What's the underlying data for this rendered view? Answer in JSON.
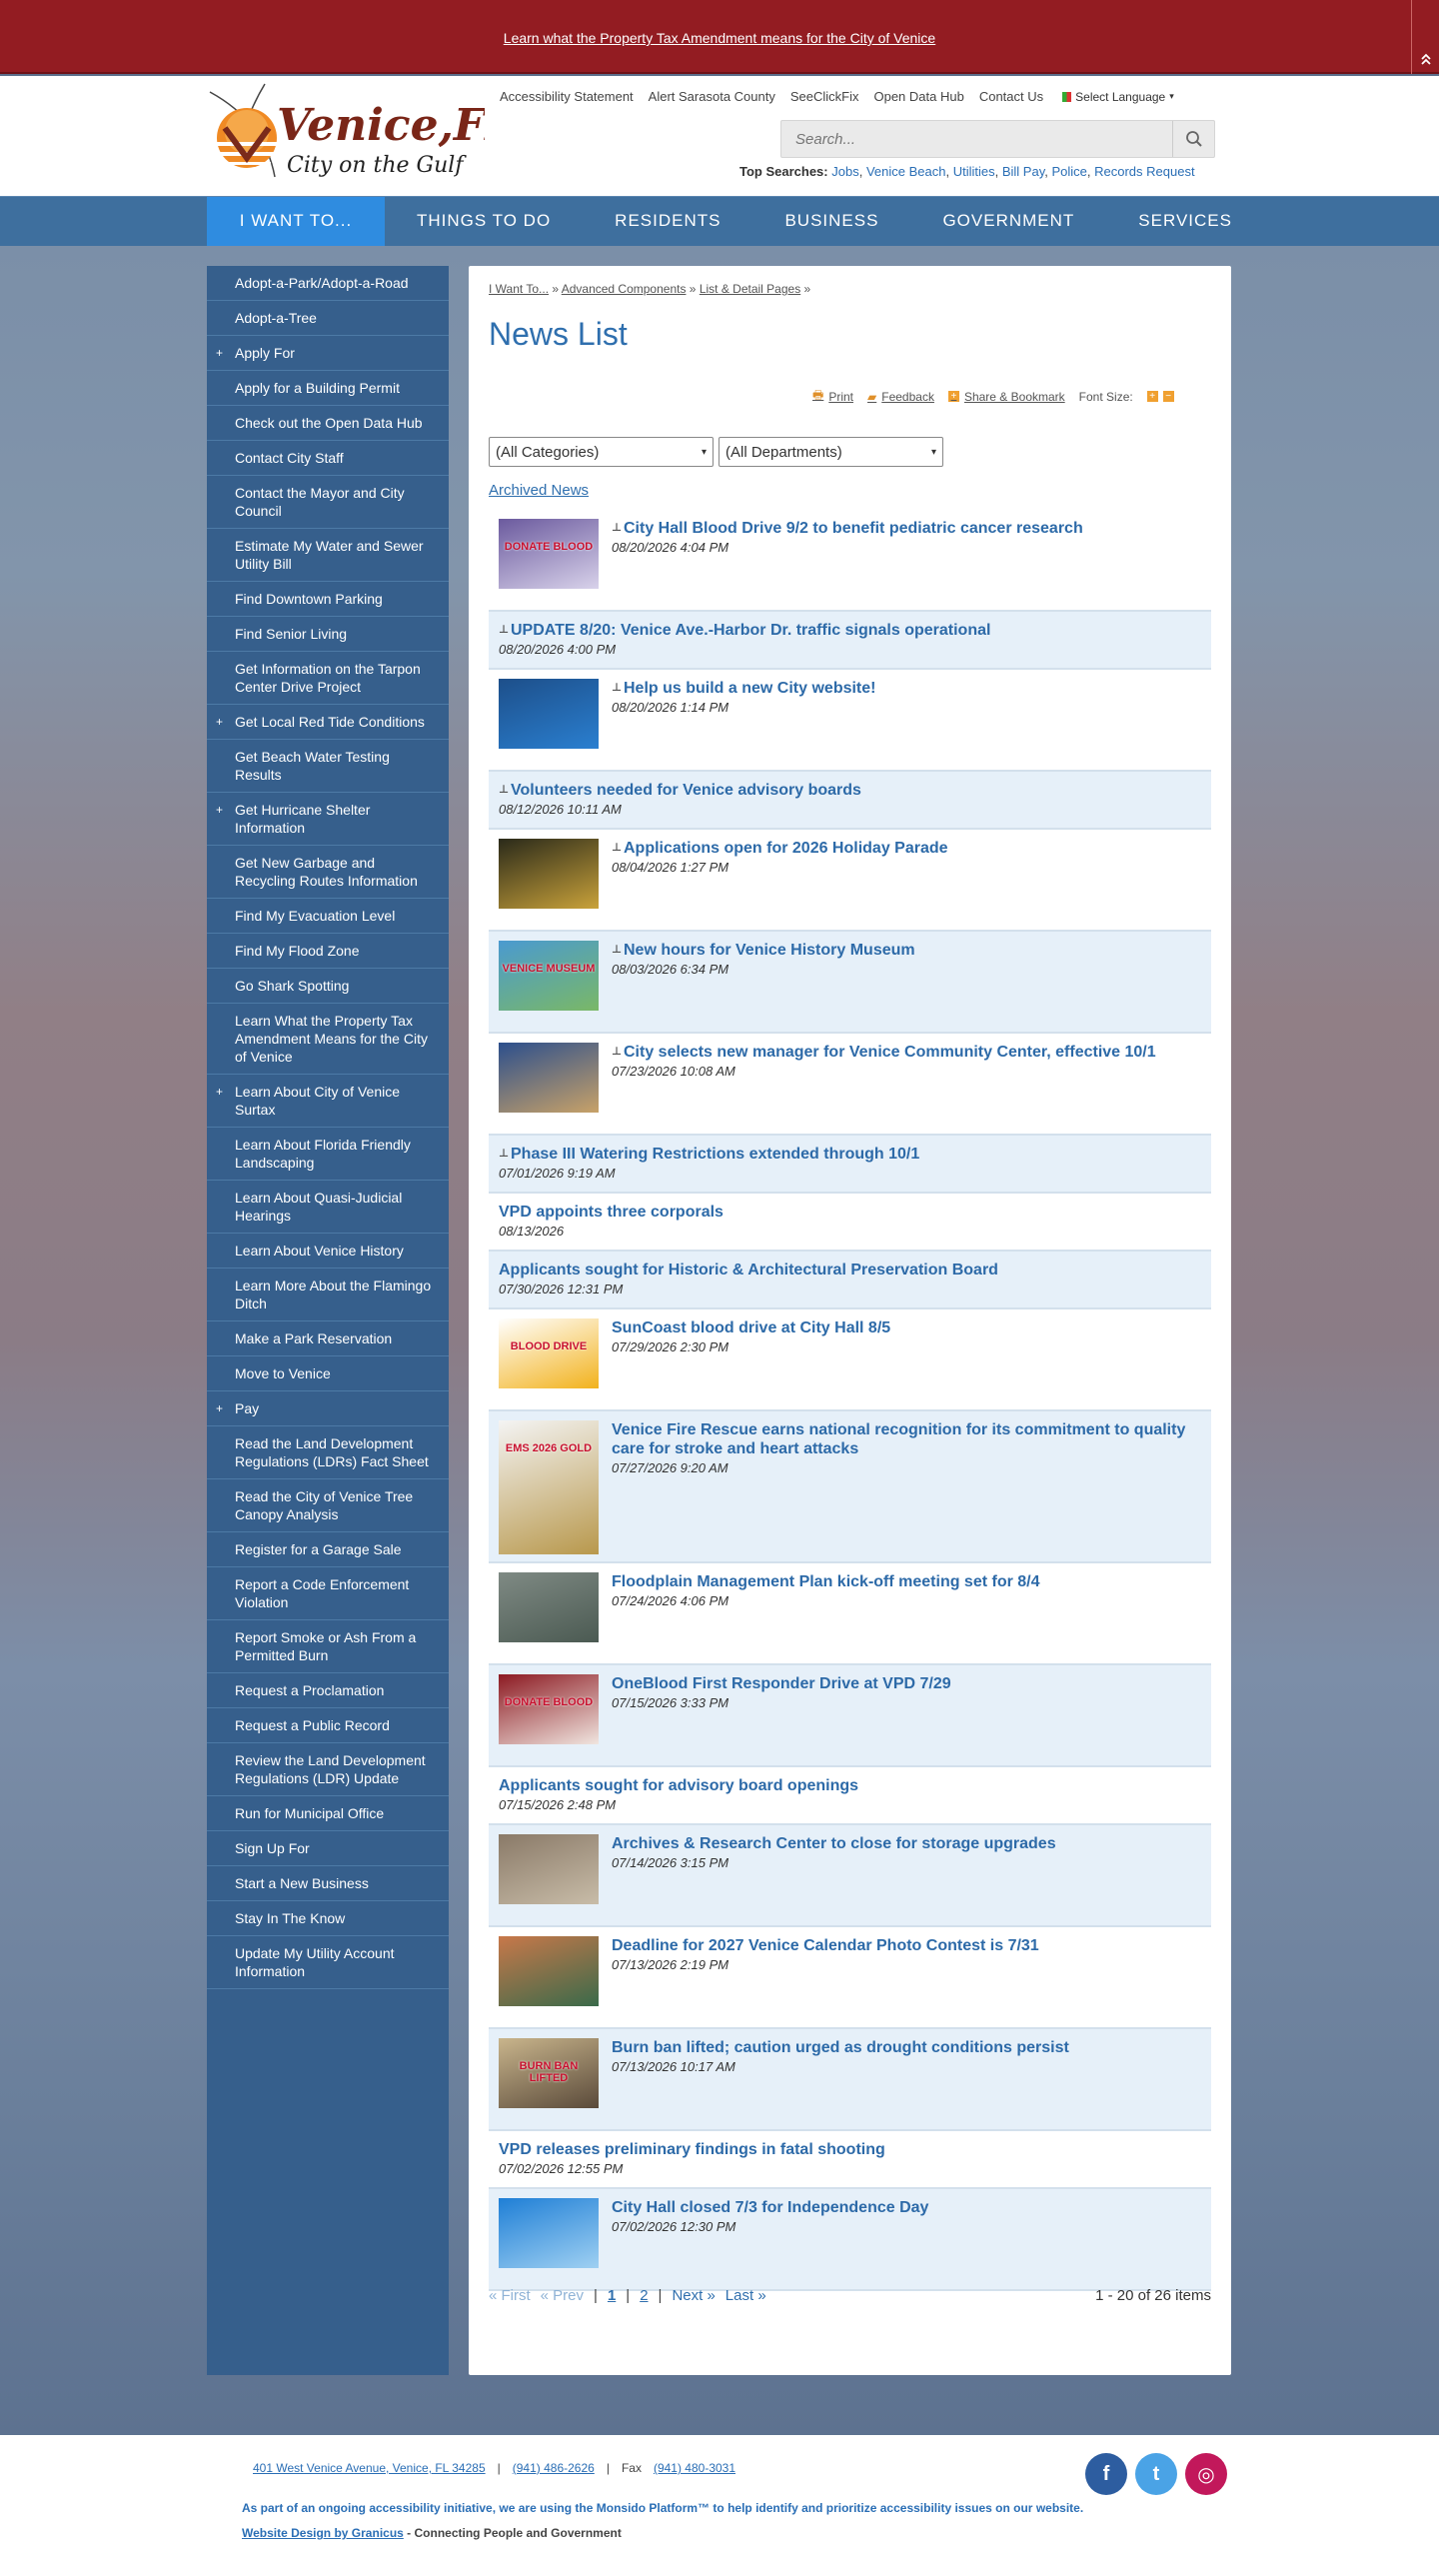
{
  "alert": {
    "message": "Learn what the Property Tax Amendment means for the City of Venice",
    "collapse_icon": "double-chevron-up-icon"
  },
  "header": {
    "logo": {
      "name": "Venice,FL",
      "tagline": "City on the Gulf"
    },
    "utility_links": [
      "Accessibility Statement",
      "Alert Sarasota County",
      "SeeClickFix",
      "Open Data Hub",
      "Contact Us"
    ],
    "language": "Select Language",
    "search": {
      "placeholder": "Search..."
    },
    "top_searches_label": "Top Searches:",
    "top_searches": [
      "Jobs",
      "Venice Beach",
      "Utilities",
      "Bill Pay",
      "Police",
      "Records Request"
    ]
  },
  "nav": [
    "I Want To...",
    "Things To Do",
    "Residents",
    "Business",
    "Government",
    "Services"
  ],
  "sidebar": [
    {
      "label": "Adopt-a-Park/Adopt-a-Road",
      "expandable": false
    },
    {
      "label": "Adopt-a-Tree",
      "expandable": false
    },
    {
      "label": "Apply For",
      "expandable": true
    },
    {
      "label": "Apply for a Building Permit",
      "expandable": false
    },
    {
      "label": "Check out the Open Data Hub",
      "expandable": false
    },
    {
      "label": "Contact City Staff",
      "expandable": false
    },
    {
      "label": "Contact the Mayor and City Council",
      "expandable": false
    },
    {
      "label": "Estimate My Water and Sewer Utility Bill",
      "expandable": false
    },
    {
      "label": "Find Downtown Parking",
      "expandable": false
    },
    {
      "label": "Find Senior Living",
      "expandable": false
    },
    {
      "label": "Get Information on the Tarpon Center Drive Project",
      "expandable": false
    },
    {
      "label": "Get Local Red Tide Conditions",
      "expandable": true
    },
    {
      "label": "Get Beach Water Testing Results",
      "expandable": false
    },
    {
      "label": "Get Hurricane Shelter Information",
      "expandable": true
    },
    {
      "label": "Get New Garbage and Recycling Routes Information",
      "expandable": false
    },
    {
      "label": "Find My Evacuation Level",
      "expandable": false
    },
    {
      "label": "Find My Flood Zone",
      "expandable": false
    },
    {
      "label": "Go Shark Spotting",
      "expandable": false
    },
    {
      "label": "Learn What the Property Tax Amendment Means for the City of Venice",
      "expandable": false
    },
    {
      "label": "Learn About City of Venice Surtax",
      "expandable": true
    },
    {
      "label": "Learn About Florida Friendly Landscaping",
      "expandable": false
    },
    {
      "label": "Learn About Quasi-Judicial Hearings",
      "expandable": false
    },
    {
      "label": "Learn About Venice History",
      "expandable": false
    },
    {
      "label": "Learn More About the Flamingo Ditch",
      "expandable": false
    },
    {
      "label": "Make a Park Reservation",
      "expandable": false
    },
    {
      "label": "Move to Venice",
      "expandable": false
    },
    {
      "label": "Pay",
      "expandable": true
    },
    {
      "label": "Read the Land Development Regulations (LDRs) Fact Sheet",
      "expandable": false
    },
    {
      "label": "Read the City of Venice Tree Canopy Analysis",
      "expandable": false
    },
    {
      "label": "Register for a Garage Sale",
      "expandable": false
    },
    {
      "label": "Report a Code Enforcement Violation",
      "expandable": false
    },
    {
      "label": "Report Smoke or Ash From a Permitted Burn",
      "expandable": false
    },
    {
      "label": "Request a Proclamation",
      "expandable": false
    },
    {
      "label": "Request a Public Record",
      "expandable": false
    },
    {
      "label": "Review the Land Development Regulations (LDR) Update",
      "expandable": false
    },
    {
      "label": "Run for Municipal Office",
      "expandable": false
    },
    {
      "label": "Sign Up For",
      "expandable": false
    },
    {
      "label": "Start a New Business",
      "expandable": false
    },
    {
      "label": "Stay In The Know",
      "expandable": false
    },
    {
      "label": "Update My Utility Account Information",
      "expandable": false
    }
  ],
  "breadcrumb": [
    "I Want To...",
    "Advanced Components",
    "List & Detail Pages"
  ],
  "page_title": "News List",
  "tools": {
    "print": "Print",
    "feedback": "Feedback",
    "share": "Share & Bookmark",
    "font_size": "Font Size:"
  },
  "filters": {
    "category": "(All Categories)",
    "department": "(All Departments)"
  },
  "archived_link": "Archived News",
  "news": [
    {
      "title": "City Hall Blood Drive 9/2 to benefit pediatric cancer research",
      "date": "08/20/2026 4:04 PM",
      "pinned": true,
      "thumb": "donate-blood-flyer",
      "thumb_colors": [
        "#6b5a9e",
        "#d8d2ea"
      ],
      "thumb_text": "DONATE BLOOD"
    },
    {
      "title": "UPDATE 8/20: Venice Ave.-Harbor Dr. traffic signals operational",
      "date": "08/20/2026 4:00 PM",
      "pinned": true
    },
    {
      "title": "Help us build a new City website!",
      "date": "08/20/2026 1:14 PM",
      "pinned": true,
      "thumb": "website-flyer",
      "thumb_colors": [
        "#1d4f8a",
        "#2a7fd0"
      ],
      "thumb_text": ""
    },
    {
      "title": "Volunteers needed for Venice advisory boards",
      "date": "08/12/2026 10:11 AM",
      "pinned": true
    },
    {
      "title": "Applications open for 2026 Holiday Parade",
      "date": "08/04/2026 1:27 PM",
      "pinned": true,
      "thumb": "parade-photo",
      "thumb_colors": [
        "#2a2a1a",
        "#c9a23a"
      ],
      "thumb_text": ""
    },
    {
      "title": "New hours for Venice History Museum",
      "date": "08/03/2026 6:34 PM",
      "pinned": true,
      "thumb": "museum-photo",
      "thumb_colors": [
        "#4a9ad0",
        "#7ab866"
      ],
      "thumb_text": "VENICE MUSEUM"
    },
    {
      "title": "City selects new manager for Venice Community Center, effective 10/1",
      "date": "07/23/2026 10:08 AM",
      "pinned": true,
      "thumb": "community-center-photo",
      "thumb_colors": [
        "#2c4f8c",
        "#c8a268"
      ],
      "thumb_text": ""
    },
    {
      "title": "Phase III Watering Restrictions extended through 10/1",
      "date": "07/01/2026 9:19 AM",
      "pinned": true
    },
    {
      "title": "VPD appoints three corporals",
      "date": "08/13/2026",
      "pinned": false
    },
    {
      "title": "Applicants sought for Historic & Architectural Preservation Board",
      "date": "07/30/2026 12:31 PM",
      "pinned": false
    },
    {
      "title": "SunCoast blood drive at City Hall 8/5",
      "date": "07/29/2026 2:30 PM",
      "pinned": false,
      "thumb": "blood-drive-sun",
      "thumb_colors": [
        "#ffffff",
        "#f2b21c"
      ],
      "thumb_text": "BLOOD DRIVE"
    },
    {
      "title": "Venice Fire Rescue earns national recognition for its commitment to quality care for stroke and heart attacks",
      "date": "07/27/2026 9:20 AM",
      "pinned": false,
      "thumb": "ems-gold-badge",
      "thumb_colors": [
        "#f4f4f4",
        "#b8984c"
      ],
      "thumb_text": "EMS 2026 GOLD"
    },
    {
      "title": "Floodplain Management Plan kick-off meeting set for 8/4",
      "date": "07/24/2026 4:06 PM",
      "pinned": false,
      "thumb": "flood-street-photo",
      "thumb_colors": [
        "#7f8a84",
        "#4b5a52"
      ],
      "thumb_text": ""
    },
    {
      "title": "OneBlood First Responder Drive at VPD 7/29",
      "date": "07/15/2026 3:33 PM",
      "pinned": false,
      "thumb": "oneblood-flyer",
      "thumb_colors": [
        "#8c1a22",
        "#f0e6e0"
      ],
      "thumb_text": "DONATE BLOOD"
    },
    {
      "title": "Applicants sought for advisory board openings",
      "date": "07/15/2026 2:48 PM",
      "pinned": false
    },
    {
      "title": "Archives & Research Center to close for storage upgrades",
      "date": "07/14/2026 3:15 PM",
      "pinned": false,
      "thumb": "archive-shelves-photo",
      "thumb_colors": [
        "#8a7a68",
        "#c8bca8"
      ],
      "thumb_text": ""
    },
    {
      "title": "Deadline for 2027 Venice Calendar Photo Contest is 7/31",
      "date": "07/13/2026 2:19 PM",
      "pinned": false,
      "thumb": "calendar-contest-photo",
      "thumb_colors": [
        "#c8784a",
        "#3a6a4a"
      ],
      "thumb_text": ""
    },
    {
      "title": "Burn ban lifted; caution urged as drought conditions persist",
      "date": "07/13/2026 10:17 AM",
      "pinned": false,
      "thumb": "fire-pit-photo",
      "thumb_colors": [
        "#c9b58c",
        "#5a4a3a"
      ],
      "thumb_text": "BURN BAN LIFTED"
    },
    {
      "title": "VPD releases preliminary findings in fatal shooting",
      "date": "07/02/2026 12:55 PM",
      "pinned": false
    },
    {
      "title": "City Hall closed 7/3 for Independence Day",
      "date": "07/02/2026 12:30 PM",
      "pinned": false,
      "thumb": "us-flag-graphic",
      "thumb_colors": [
        "#1f7fd6",
        "#9fd0f2"
      ],
      "thumb_text": ""
    }
  ],
  "pagination": {
    "first": "« First",
    "prev": "« Prev",
    "pages": [
      "1",
      "2"
    ],
    "current": "1",
    "next": "Next »",
    "last": "Last »",
    "summary": "1 - 20 of 26 items"
  },
  "footer": {
    "address": "401 West Venice Avenue, Venice, FL 34285",
    "phone": "(941) 486-2626",
    "fax_label": "Fax",
    "fax": "(941) 480-3031",
    "accessibility": "As part of an ongoing accessibility initiative, we are using the Monsido Platform™ to help identify and prioritize accessibility issues on our website.",
    "credit_link": "Website Design by Granicus",
    "credit_text": " - Connecting People and Government",
    "social": [
      {
        "name": "facebook-icon",
        "glyph": "f",
        "color": "#2d5da0"
      },
      {
        "name": "twitter-icon",
        "glyph": "t",
        "color": "#4aa3e6"
      },
      {
        "name": "instagram-icon",
        "glyph": "◎",
        "color": "#c2185b"
      }
    ]
  },
  "colors": {
    "alert": "#931c22",
    "nav": "#3e6f9e",
    "nav_active": "#2f8ce0",
    "sidebar": "#365f8c",
    "link": "#2d6aa8"
  }
}
